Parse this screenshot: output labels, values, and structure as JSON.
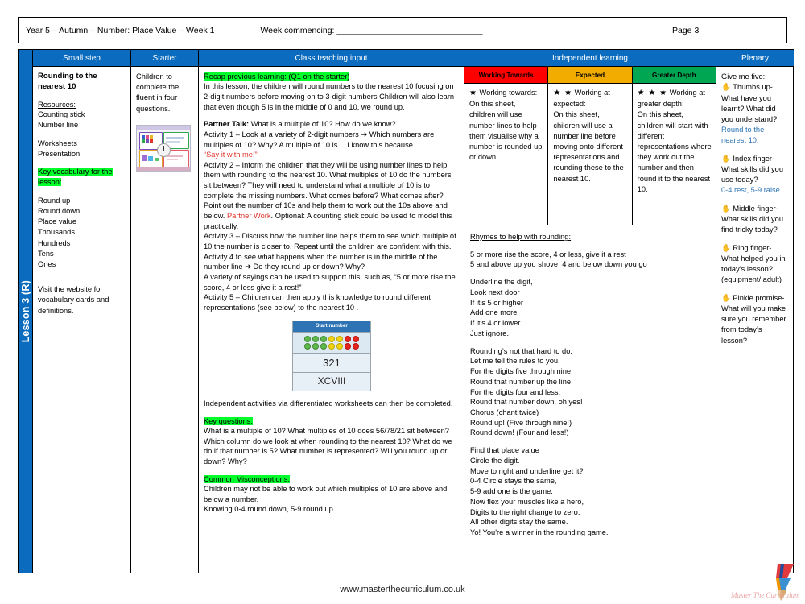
{
  "header": {
    "term": "Year 5 – Autumn – Number: Place Value – Week 1",
    "week_commencing": "Week commencing: _______________________________",
    "page": "Page 3"
  },
  "lesson_tab": "Lesson 3 (R)",
  "columns": {
    "small_step": "Small step",
    "starter": "Starter",
    "class_teaching_input": "Class teaching input",
    "independent_learning": "Independent learning",
    "plenary": "Plenary"
  },
  "small_step": {
    "title": "Rounding to the nearest 10",
    "resources_label": "Resources:",
    "resources": [
      "Counting stick",
      "Number line"
    ],
    "resources2": [
      "Worksheets",
      "Presentation"
    ],
    "key_vocab_label": "Key vocabulary for the lesson:",
    "vocab": [
      "Round up",
      "Round down",
      "Place value",
      "Thousands",
      "Hundreds",
      "Tens",
      "Ones"
    ],
    "website_note": "Visit the website for vocabulary cards and definitions."
  },
  "starter": {
    "text": "Children to complete the fluent in four questions.",
    "thumbnail_alt": "fluent-in-four-worksheet-thumbnail"
  },
  "teaching": {
    "recap_label": "Recap previous learning: (Q1 on the starter)",
    "recap_body": "In this lesson, the children will round numbers to the nearest 10 focusing on 2-digit numbers before moving on to 3-digit numbers Children will also learn that even though 5 is in the middle of 0 and 10, we round up.",
    "partner_talk_label": "Partner Talk:",
    "partner_talk_q": " What is a multiple of 10? How do we know?",
    "activity1": "Activity 1 – Look at a variety of 2-digit numbers ➔ Which numbers are multiples of 10? Why? A multiple of 10 is… I know this because…",
    "say_it": "“Say it with me!”",
    "activity2a": "Activity 2 – Inform the children that they will be using number lines to help them with rounding to the nearest 10. What multiples of 10 do the numbers sit between? They will need to understand what a multiple of 10 is to complete the missing numbers. What comes before? What comes after? Point out the number of 10s and help them to work out the 10s above and below. ",
    "partner_work": "Partner Work",
    "activity2b": ". Optional: A counting stick could be used to model this practically.",
    "activity3": "Activity 3 – Discuss how the number line helps them to see which multiple of 10 the number is closer to. Repeat until the children are confident with this.",
    "activity4": "Activity 4 to see what happens when the number is in the middle of the number line ➔ Do they round up or down? Why?",
    "sayings": "A variety of sayings can be used to support this, such as, “5 or more rise the score, 4 or less give it a rest!”",
    "activity5": "Activity 5 – Children can then apply this knowledge to round different representations (see below) to the nearest 10 .",
    "mini_table": {
      "header": "Start number",
      "counters_row1": [
        "g",
        "g",
        "g",
        "y",
        "y",
        "r",
        "r"
      ],
      "counters_row2": [
        "g",
        "g",
        "g",
        "y",
        "y",
        "r",
        "r"
      ],
      "number": "321",
      "roman": "XCVIII"
    },
    "independent_note": "Independent activities via differentiated worksheets can then be completed.",
    "key_questions_label": "Key questions:",
    "key_questions": "What is a multiple of 10? What multiples of 10 does 56/78/21 sit between? Which column do we look at when rounding to the nearest 10? What do we do if that number is 5? What number is represented? Will you round up or down? Why?",
    "misconceptions_label": "Common Misconceptions:",
    "misconceptions1": "Children may not be able to work out which multiples of 10 are above and below a number.",
    "misconceptions2": "Knowing 0-4 round down, 5-9 round up."
  },
  "independent": {
    "bands": [
      {
        "label": "Working Towards",
        "color": "#ff0000",
        "stars": "★",
        "heading": " Working towards:",
        "body": "On this sheet, children will use number lines to help them visualise why a number is rounded up or down."
      },
      {
        "label": "Expected",
        "color": "#f2ac00",
        "stars": "★ ★",
        "heading": " Working at expected:",
        "body": "On this sheet, children will use a number line before moving onto different representations and rounding these to the nearest 10."
      },
      {
        "label": "Greater Depth",
        "color": "#00a651",
        "stars": "★ ★ ★",
        "heading": " Working at greater depth:",
        "body": "On this sheet, children will start with different representations where they work out the number and then round it to the nearest 10."
      }
    ],
    "rhymes_title": "Rhymes to help with rounding:",
    "rhyme_stanzas": [
      [
        "5 or more rise the score, 4 or less, give it a rest",
        "5 and above up you shove, 4 and below down you go"
      ],
      [
        "Underline the digit,",
        "Look next door",
        "If it’s 5 or higher",
        "Add one more",
        "If it’s 4 or lower",
        "Just ignore."
      ],
      [
        "Rounding’s not that hard to do.",
        "Let me tell the rules to you.",
        "For the digits five through nine,",
        "Round that number up the line.",
        "For the digits four and less,",
        "Round that number down, oh yes!",
        "Chorus (chant twice)",
        "Round up! (Five through nine!)",
        "Round down! (Four and less!)"
      ],
      [
        "Find that place value",
        "Circle the digit.",
        "Move to right and underline get it?",
        "0-4 Circle stays the same,",
        "5-9 add one is the game.",
        "Now flex your muscles like a hero,",
        "Digits to the right change to zero.",
        "All other digits stay the same.",
        "Yo! You're a winner in the rounding game."
      ]
    ]
  },
  "plenary": {
    "intro": "Give me five:",
    "items": [
      {
        "icon": "hand-icon",
        "text": " Thumbs up- What have you learnt? What did you understand?",
        "answer": "Round to the nearest 10."
      },
      {
        "icon": "hand-icon",
        "text": " Index finger- What skills did you use today?",
        "answer": "0-4 rest, 5-9 raise."
      },
      {
        "icon": "hand-icon",
        "text": " Middle finger- What skills did you find tricky today?",
        "answer": ""
      },
      {
        "icon": "hand-icon",
        "text": " Ring finger- What helped you in today’s lesson? (equipment/ adult)",
        "answer": ""
      },
      {
        "icon": "hand-icon",
        "text": " Pinkie promise- What will you make sure you remember from today’s lesson?",
        "answer": ""
      }
    ]
  },
  "footer": {
    "url": "www.masterthecurriculum.co.uk",
    "logo_text": "Master The Curriculum"
  },
  "colors": {
    "header_blue": "#0b6cbf",
    "highlight_green": "#00ff2b",
    "red_text": "#e0342b",
    "blue_text": "#2e74b5",
    "working_towards": "#ff0000",
    "expected": "#f2ac00",
    "greater_depth": "#00a651"
  }
}
